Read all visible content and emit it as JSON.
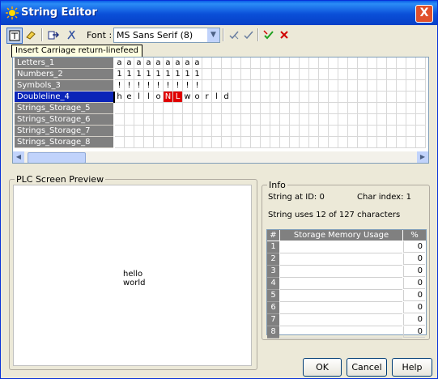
{
  "window": {
    "title": "String Editor",
    "close_label": "X"
  },
  "toolbar": {
    "font_label": "Font :",
    "font_value": "MS Sans Serif (8)"
  },
  "tooltip": "Insert Carriage return-linefeed",
  "strings": [
    {
      "name": "Letters_1",
      "chars": [
        "a",
        "a",
        "a",
        "a",
        "a",
        "a",
        "a",
        "a",
        "a"
      ],
      "highlight": []
    },
    {
      "name": "Numbers_2",
      "chars": [
        "1",
        "1",
        "1",
        "1",
        "1",
        "1",
        "1",
        "1",
        "1"
      ],
      "highlight": []
    },
    {
      "name": "Symbols_3",
      "chars": [
        "!",
        "!",
        "!",
        "!",
        "!",
        "!",
        "!",
        "!",
        "!"
      ],
      "highlight": []
    },
    {
      "name": "Doubleline_4",
      "chars": [
        "h",
        "e",
        "l",
        "l",
        "o",
        "N",
        "L",
        "w",
        "o",
        "r",
        "l",
        "d"
      ],
      "highlight": [
        5,
        6
      ],
      "selected": true
    },
    {
      "name": "Strings_Storage_5",
      "chars": [],
      "highlight": []
    },
    {
      "name": "Strings_Storage_6",
      "chars": [],
      "highlight": []
    },
    {
      "name": "Strings_Storage_7",
      "chars": [],
      "highlight": []
    },
    {
      "name": "Strings_Storage_8",
      "chars": [],
      "highlight": []
    }
  ],
  "preview": {
    "title": "PLC Screen Preview",
    "line1": "hello",
    "line2": "world"
  },
  "info": {
    "title": "Info",
    "string_id": "String at ID: 0",
    "char_index": "Char index: 1",
    "usage": "String uses 12 of 127 characters"
  },
  "storage_table": {
    "col_num": "#",
    "col_usage": "Storage Memory Usage",
    "col_pct": "%",
    "rows": [
      {
        "num": "1",
        "pct": "0"
      },
      {
        "num": "2",
        "pct": "0"
      },
      {
        "num": "3",
        "pct": "0"
      },
      {
        "num": "4",
        "pct": "0"
      },
      {
        "num": "5",
        "pct": "0"
      },
      {
        "num": "6",
        "pct": "0"
      },
      {
        "num": "7",
        "pct": "0"
      },
      {
        "num": "8",
        "pct": "0"
      }
    ]
  },
  "buttons": {
    "ok": "OK",
    "cancel": "Cancel",
    "help": "Help"
  },
  "colors": {
    "title_bar": "#0a4fd8",
    "highlight": "#e00000",
    "selected_row": "#0a24b8"
  }
}
